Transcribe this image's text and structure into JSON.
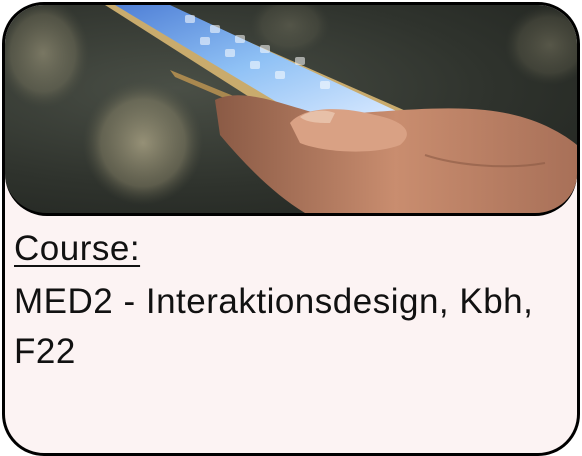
{
  "card": {
    "image": {
      "subject": "hand-holding-smartphone-icon",
      "colors": {
        "background": "#2f332d",
        "phone_gold": "#b8985a",
        "screen_blue": "#7fb3ef",
        "skin": "#c98d6f"
      }
    },
    "course_label": "Course:",
    "course_name": "MED2 - Interaktionsdesign, Kbh, F22",
    "colors": {
      "card_background": "#fcf3f3",
      "border": "#000000",
      "text": "#111111"
    }
  }
}
